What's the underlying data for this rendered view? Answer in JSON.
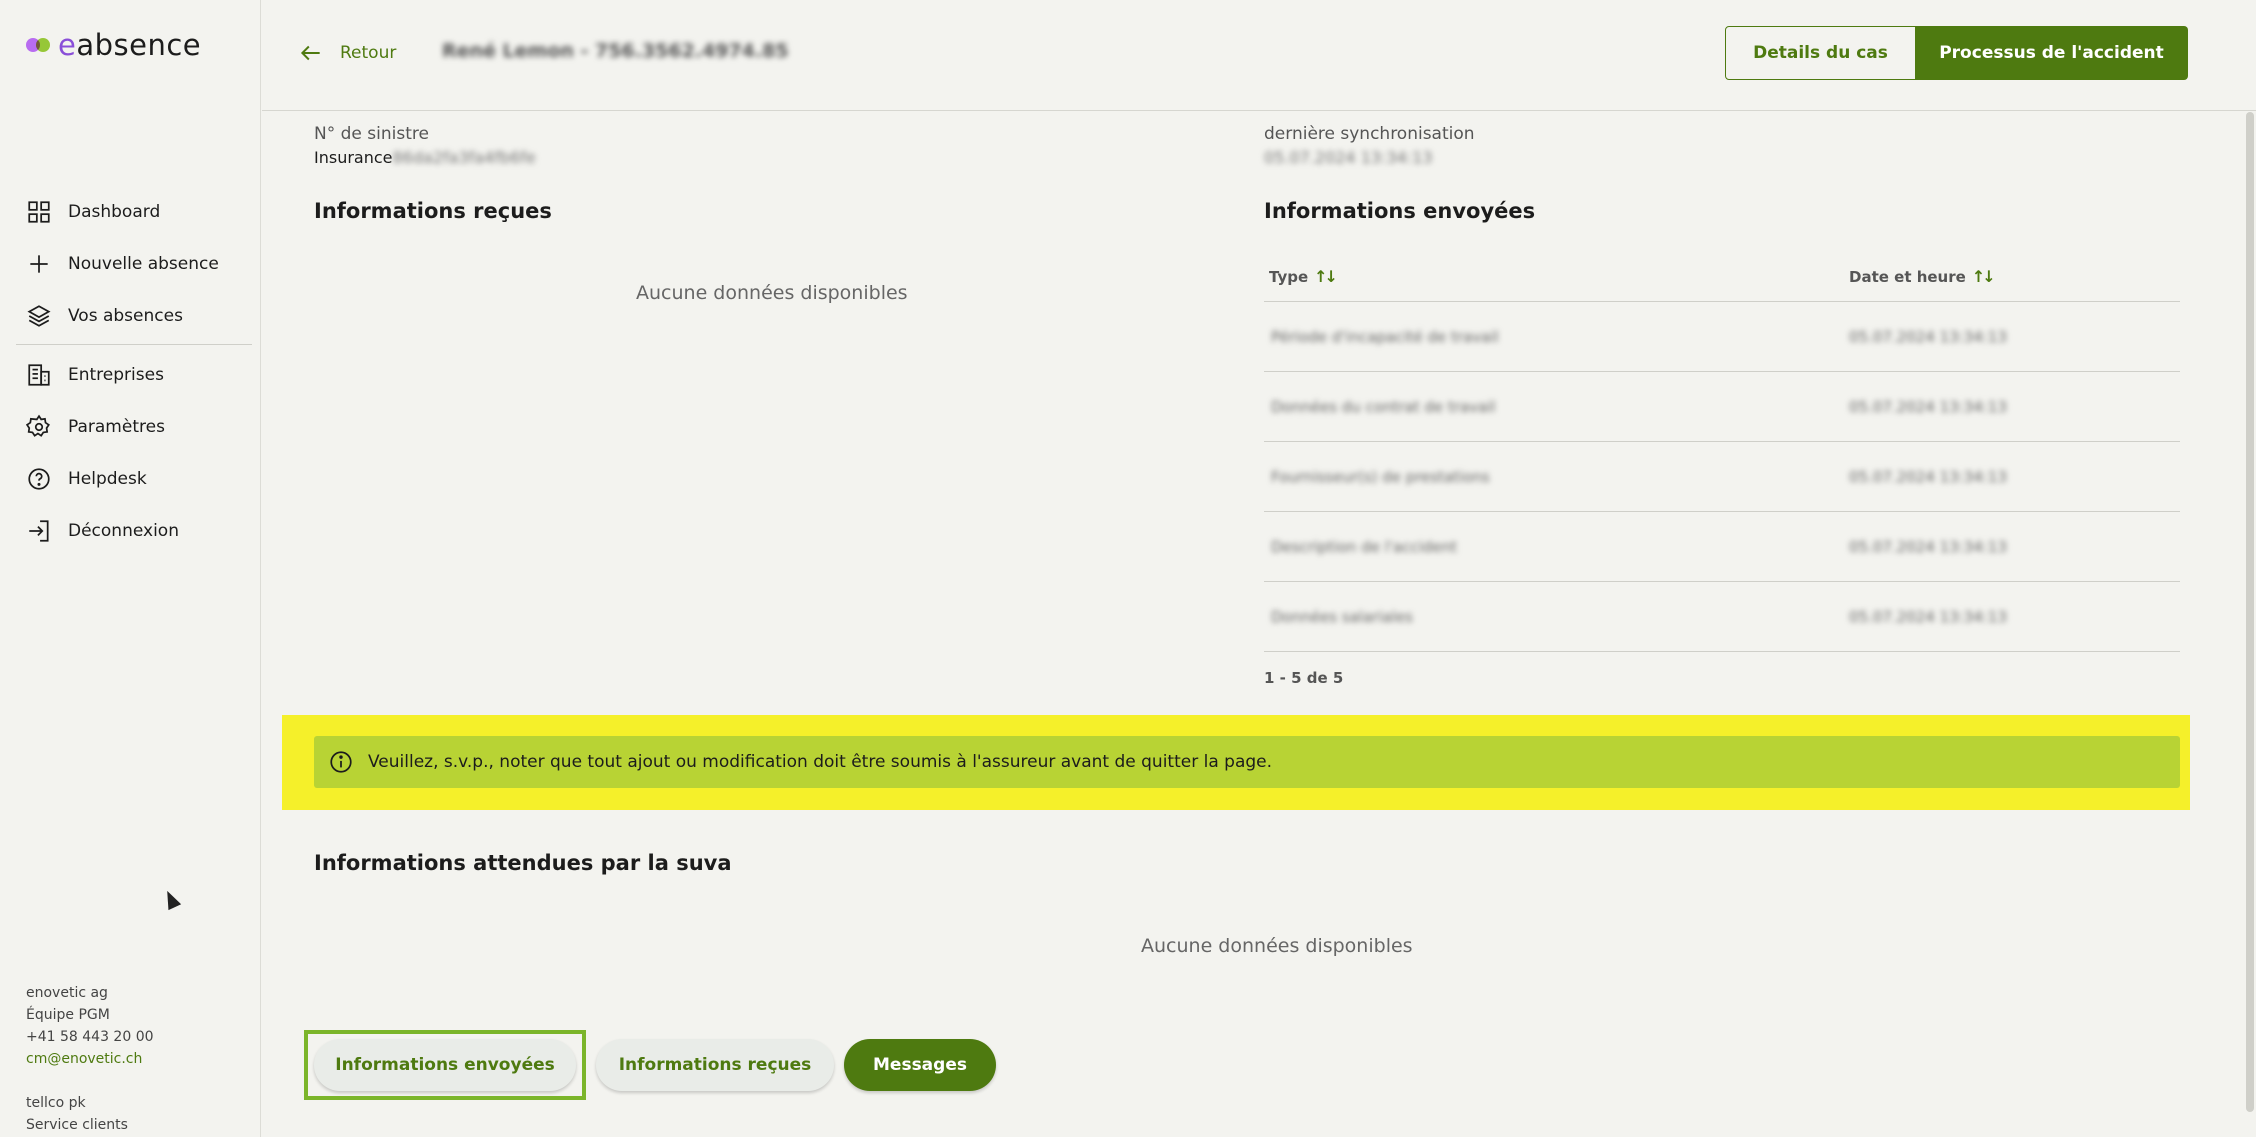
{
  "brand": {
    "name_prefix": "e",
    "name_rest": "absence"
  },
  "sidebar": {
    "items": [
      {
        "label": "Dashboard",
        "icon": "grid-icon"
      },
      {
        "label": "Nouvelle absence",
        "icon": "plus-icon"
      },
      {
        "label": "Vos absences",
        "icon": "layers-icon"
      },
      {
        "label": "Entreprises",
        "icon": "building-icon"
      },
      {
        "label": "Paramètres",
        "icon": "gear-icon"
      },
      {
        "label": "Helpdesk",
        "icon": "help-circle-icon"
      },
      {
        "label": "Déconnexion",
        "icon": "logout-icon"
      }
    ],
    "footer": {
      "company": "enovetic ag",
      "team": "Équipe PGM",
      "phone": "+41 58 443 20 00",
      "email": "cm@enovetic.ch",
      "org2": "tellco pk",
      "service": "Service clients"
    }
  },
  "header": {
    "back_label": "Retour",
    "title": "René Lemon - 756.3562.4974.85",
    "details_button": "Details du cas",
    "process_button": "Processus de l'accident"
  },
  "claim": {
    "number_label": "N° de sinistre",
    "number_prefix": "Insurance",
    "number_value": "86da2fa3fa4fb6fe",
    "sync_label": "dernière synchronisation",
    "sync_value": "05.07.2024 13:34:13"
  },
  "received": {
    "title": "Informations reçues",
    "empty": "Aucune données disponibles"
  },
  "sent": {
    "title": "Informations envoyées",
    "columns": {
      "type": "Type",
      "date": "Date et heure"
    },
    "rows": [
      {
        "type": "Période d'incapacité de travail",
        "date": "05.07.2024 13:34:13"
      },
      {
        "type": "Données du contrat de travail",
        "date": "05.07.2024 13:34:13"
      },
      {
        "type": "Fournisseur(s) de prestations",
        "date": "05.07.2024 13:34:13"
      },
      {
        "type": "Description de l'accident",
        "date": "05.07.2024 13:34:13"
      },
      {
        "type": "Données salariales",
        "date": "05.07.2024 13:34:13"
      }
    ],
    "pagination": "1 - 5 de 5"
  },
  "notice": {
    "text": "Veuillez, s.v.p., noter que tout ajout ou modification doit être soumis à l'assureur avant de quitter la page."
  },
  "expected": {
    "title": "Informations attendues par la suva",
    "empty": "Aucune données disponibles"
  },
  "tabs": {
    "sent": "Informations envoyées",
    "received": "Informations reçues",
    "messages": "Messages"
  },
  "colors": {
    "accent": "#4e7a10",
    "highlight": "#f5f02a",
    "notice_bg": "#b8d334",
    "background": "#f3f3ef"
  }
}
